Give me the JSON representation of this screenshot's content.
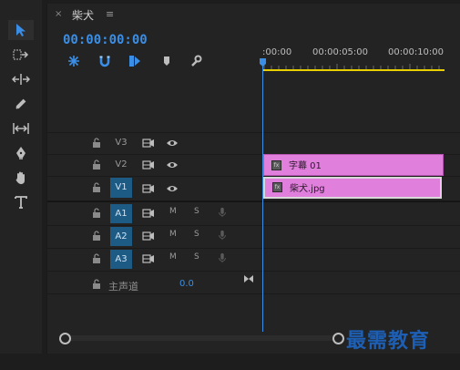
{
  "panel": {
    "close_glyph": "×",
    "title": "柴犬",
    "menu_glyph": "≡",
    "timecode": "00:00:00:00"
  },
  "header_icons": [
    "snap-nest-icon",
    "magnet-snap-icon",
    "linked-selection-icon",
    "add-marker-icon",
    "wrench-settings-icon"
  ],
  "tools": [
    "selection-tool-icon",
    "track-select-forward-icon",
    "ripple-edit-icon",
    "razor-icon",
    "slip-icon",
    "pen-icon",
    "hand-icon",
    "type-icon"
  ],
  "ruler": {
    "labels": [
      ":00:00",
      "00:00:05:00",
      "00:00:10:00"
    ]
  },
  "tracks": {
    "video": [
      {
        "name": "V3",
        "targeted": false
      },
      {
        "name": "V2",
        "targeted": false
      },
      {
        "name": "V1",
        "targeted": true
      }
    ],
    "audio": [
      {
        "name": "A1",
        "targeted": true,
        "mute": "M",
        "solo": "S"
      },
      {
        "name": "A2",
        "targeted": true,
        "mute": "M",
        "solo": "S"
      },
      {
        "name": "A3",
        "targeted": true,
        "mute": "M",
        "solo": "S"
      }
    ],
    "master": {
      "label": "主声道",
      "value": "0.0"
    }
  },
  "clips": [
    {
      "track": "V2",
      "label": "字幕 01",
      "color": "#e07fdc"
    },
    {
      "track": "V1",
      "label": "柴犬.jpg",
      "color": "#e07fdc"
    }
  ],
  "colors": {
    "accent": "#3a8ee6",
    "targeted_track": "#1d5b85",
    "work_area": "#e8d000",
    "clip": "#e07fdc"
  },
  "watermark": "最需教育"
}
